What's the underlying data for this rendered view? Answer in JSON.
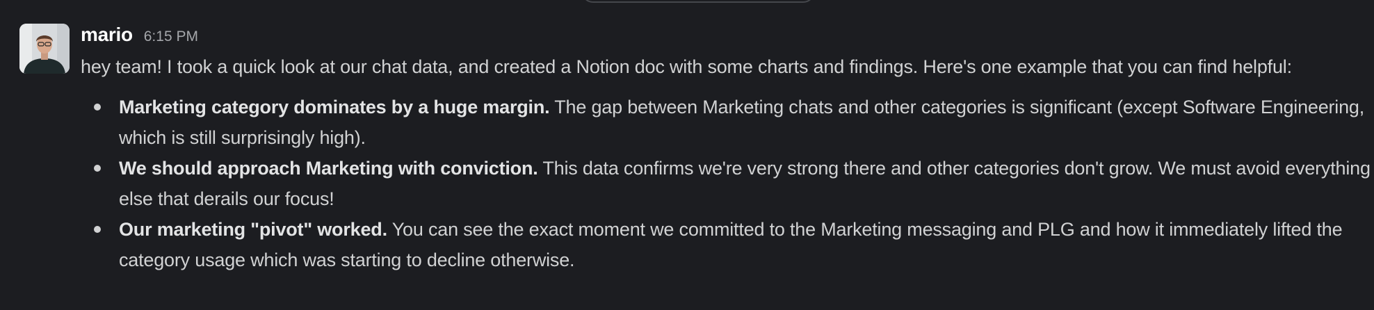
{
  "message": {
    "sender": "mario",
    "timestamp": "6:15 PM",
    "intro": "hey team! I took a quick look at our chat data, and created a Notion doc with some charts and findings. Here's one example that you can find helpful:",
    "bullets": [
      {
        "bold": "Marketing category dominates by a huge margin.",
        "text": " The gap between Marketing chats and other categories is significant (except Software Engineering, which is still surprisingly high)."
      },
      {
        "bold": "We should approach Marketing with conviction.",
        "text": " This data confirms we're very strong there and other categories don't grow. We must avoid everything else that derails our focus!"
      },
      {
        "bold": "Our marketing \"pivot\" worked.",
        "text": " You can see the exact moment we committed to the Marketing messaging and PLG and how it immediately lifted the category usage which was starting to decline otherwise."
      }
    ]
  },
  "colors": {
    "background": "#1c1d21",
    "text": "#d1d2d3",
    "sender": "#ffffff",
    "timestamp": "#a5a7ab"
  },
  "icons": {
    "avatar": "user-photo"
  }
}
